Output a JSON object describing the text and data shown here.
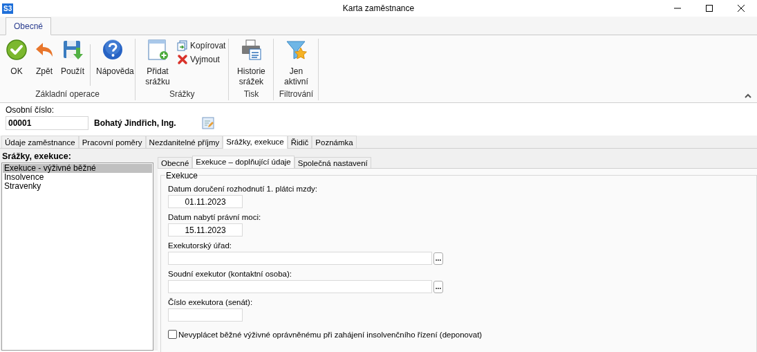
{
  "window": {
    "app_badge": "S3",
    "title": "Karta zaměstnance"
  },
  "ribbon": {
    "tabs": [
      {
        "label": "Obecné",
        "selected": true
      }
    ],
    "groups": [
      {
        "label": "Základní operace",
        "items": [
          {
            "kind": "large",
            "label": "OK"
          },
          {
            "kind": "large",
            "label": "Zpět"
          },
          {
            "kind": "large",
            "label": "Použít"
          },
          {
            "kind": "separator"
          },
          {
            "kind": "large",
            "label": "Nápověda"
          }
        ]
      },
      {
        "label": "Srážky",
        "items": [
          {
            "kind": "large",
            "label": "Přidat srážku"
          },
          {
            "kind": "small-stack",
            "buttons": [
              {
                "label": "Kopírovat"
              },
              {
                "label": "Vyjmout"
              }
            ]
          }
        ]
      },
      {
        "label": "Tisk",
        "items": [
          {
            "kind": "large",
            "label": "Historie srážek"
          }
        ]
      },
      {
        "label": "Filtrování",
        "items": [
          {
            "kind": "large",
            "label": "Jen aktivní"
          }
        ]
      }
    ]
  },
  "employee": {
    "label": "Osobní číslo:",
    "number": "00001",
    "name": "Bohatý Jindřich, Ing."
  },
  "tabs": [
    {
      "label": "Údaje zaměstnance",
      "selected": false
    },
    {
      "label": "Pracovní poměry",
      "selected": false
    },
    {
      "label": "Nezdanitelné příjmy",
      "selected": false
    },
    {
      "label": "Srážky, exekuce",
      "selected": true
    },
    {
      "label": "Řidič",
      "selected": false
    },
    {
      "label": "Poznámka",
      "selected": false
    }
  ],
  "sidebar": {
    "title": "Srážky, exekuce:",
    "items": [
      {
        "label": "Exekuce - výživné běžné",
        "selected": true
      },
      {
        "label": "Insolvence",
        "selected": false
      },
      {
        "label": "Stravenky",
        "selected": false
      }
    ]
  },
  "subtabs": [
    {
      "label": "Obecné",
      "selected": false
    },
    {
      "label": "Exekuce – doplňující údaje",
      "selected": true
    },
    {
      "label": "Společná nastavení",
      "selected": false
    }
  ],
  "groupbox": {
    "title": "Exekuce",
    "fields": [
      {
        "kind": "date",
        "label": "Datum doručení rozhodnutí 1. plátci mzdy:",
        "value": "01.11.2023"
      },
      {
        "kind": "date",
        "label": "Datum nabytí právní moci:",
        "value": "15.11.2023"
      },
      {
        "kind": "lookup",
        "label": "Exekutorský úřad:",
        "button": "..."
      },
      {
        "kind": "lookup",
        "label": "Soudní exekutor (kontaktní osoba):",
        "button": "..."
      },
      {
        "kind": "date",
        "label": "Číslo exekutora (senát):"
      }
    ],
    "checkbox": {
      "label": "Nevyplácet běžné výživné oprávněnému při zahájení insolvenčního řízení (deponovat)",
      "checked": false
    }
  }
}
